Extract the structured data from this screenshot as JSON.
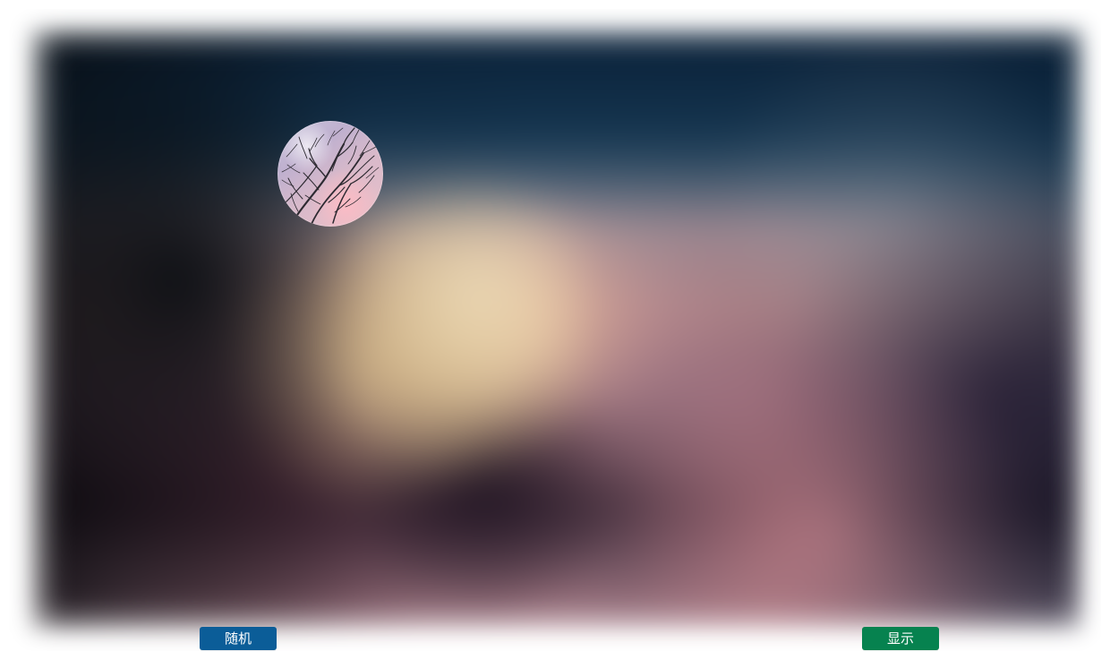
{
  "controls": {
    "random_label": "随机",
    "show_label": "显示"
  },
  "colors": {
    "random_button": "#0b5d98",
    "show_button": "#06824f",
    "page_background": "#ffffff"
  }
}
